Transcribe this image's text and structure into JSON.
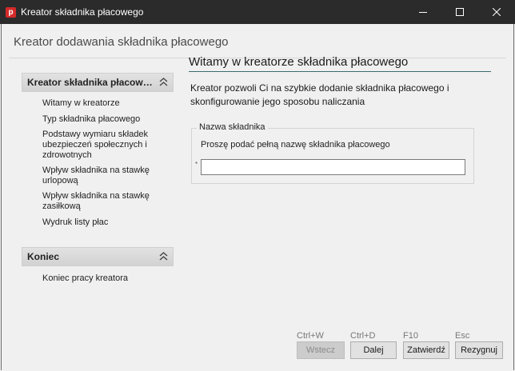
{
  "window": {
    "title": "Kreator składnika płacowego",
    "icon_letter": "p",
    "controls": [
      "minimize-icon",
      "maximize-icon",
      "close-icon"
    ]
  },
  "header": {
    "title": "Kreator dodawania składnika płacowego"
  },
  "sidebar": {
    "sections": [
      {
        "title": "Kreator składnika płacowego",
        "items": [
          "Witamy w kreatorze",
          "Typ składnika płacowego",
          "Podstawy wymiaru składek ubezpieczeń społecznych i zdrowotnych",
          "Wpływ składnika na stawkę urlopową",
          "Wpływ składnika na stawkę zasiłkową",
          "Wydruk listy płac"
        ]
      },
      {
        "title": "Koniec",
        "items": [
          "Koniec pracy kreatora"
        ]
      }
    ]
  },
  "main": {
    "title": "Witamy w kreatorze składnika płacowego",
    "description": "Kreator pozwoli Ci na szybkie dodanie składnika płacowego i skonfigurowanie jego sposobu naliczania",
    "group": {
      "legend": "Nazwa składnika",
      "hint": "Proszę podać pełną nazwę składnika płacowego",
      "required_mark": "*",
      "value": ""
    }
  },
  "footer": {
    "buttons": [
      {
        "shortcut": "Ctrl+W",
        "label": "Wstecz",
        "enabled": false
      },
      {
        "shortcut": "Ctrl+D",
        "label": "Dalej",
        "enabled": true
      },
      {
        "shortcut": "F10",
        "label": "Zatwierdź",
        "enabled": true
      },
      {
        "shortcut": "Esc",
        "label": "Rezygnuj",
        "enabled": true
      }
    ]
  },
  "colors": {
    "titlebar": "#2b2b2b",
    "app_icon": "#d42a2a",
    "title_rule": "#3c6b6b",
    "background": "#f0f0f0"
  }
}
